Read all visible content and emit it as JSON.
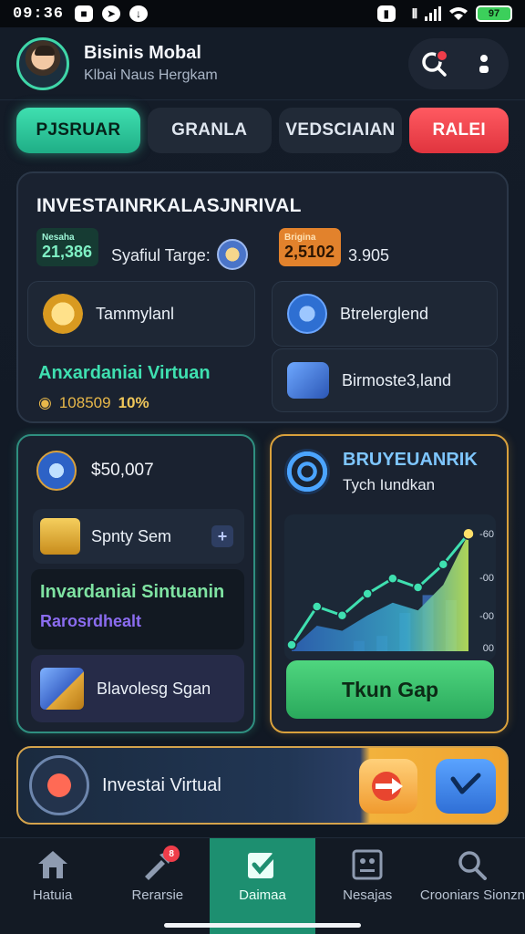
{
  "status": {
    "time": "09:36",
    "battery": "97"
  },
  "header": {
    "title": "Bisinis Mobal",
    "subtitle": "Klbai Naus Hergkam"
  },
  "tabs": [
    {
      "label": "PJSRUAR",
      "state": "active"
    },
    {
      "label": "GRANLA",
      "state": "normal"
    },
    {
      "label": "VEDSCIAIAN",
      "state": "normal"
    },
    {
      "label": "RALEI",
      "state": "alert"
    }
  ],
  "summary": {
    "title": "INVESTAINRKALASJNRIVAL",
    "metric1": {
      "label": "Nesaha",
      "value": "21,386"
    },
    "metric1_text": "Syafiul Targe:",
    "metric2": {
      "label": "Brigina",
      "value": "2,5102"
    },
    "metric2_text": "3.905",
    "card_a": "Tammylanl",
    "card_b": "Btrelerglend",
    "card_c": "Birmoste3,land",
    "green_text": "Anxardaniai Virtuan",
    "pct_number": "108509",
    "pct_value": "10%"
  },
  "left_card": {
    "balance": "$50,007",
    "item_label": "Spnty Sem",
    "plus": "+",
    "highlight_title": "Invardaniai Sintuanin",
    "highlight_sub": "Rarosrdhealt",
    "bottom_label": "Blavolesg Sgan"
  },
  "right_card": {
    "title": "BRUYEUANRIK",
    "subtitle": "Tych Iundkan",
    "cta": "Tkun Gap"
  },
  "chart_data": {
    "type": "line",
    "title": "",
    "xlabel": "",
    "ylabel": "",
    "ytick_labels": [
      "-60",
      "-00",
      "-00",
      "00"
    ],
    "series": [
      {
        "values": [
          5,
          35,
          28,
          45,
          57,
          50,
          68,
          92
        ]
      },
      {
        "values": [
          2,
          20,
          16,
          28,
          38,
          32,
          52,
          92
        ]
      }
    ],
    "bars": [
      8,
      12,
      30,
      44,
      40
    ],
    "ylim": [
      0,
      100
    ],
    "colors": {
      "line": "#3fe0b0",
      "area_top": "#3a7fd6",
      "area_bottom": "#bfe85a",
      "highlight": "#ffe06a"
    }
  },
  "banner": {
    "label": "Investai Virtual"
  },
  "nav": [
    {
      "label": "Hatuia",
      "icon": "home-icon"
    },
    {
      "label": "Rerarsie",
      "icon": "tools-icon",
      "badge": "8"
    },
    {
      "label": "Daimaa",
      "icon": "check-icon",
      "active": true
    },
    {
      "label": "Nesajas",
      "icon": "frame-icon"
    },
    {
      "label": "Crooniars Sionzn",
      "icon": "search-icon"
    }
  ],
  "colors": {
    "accent": "#3fe0b0",
    "alert": "#ef3d4a",
    "gold": "#d9a13c"
  }
}
